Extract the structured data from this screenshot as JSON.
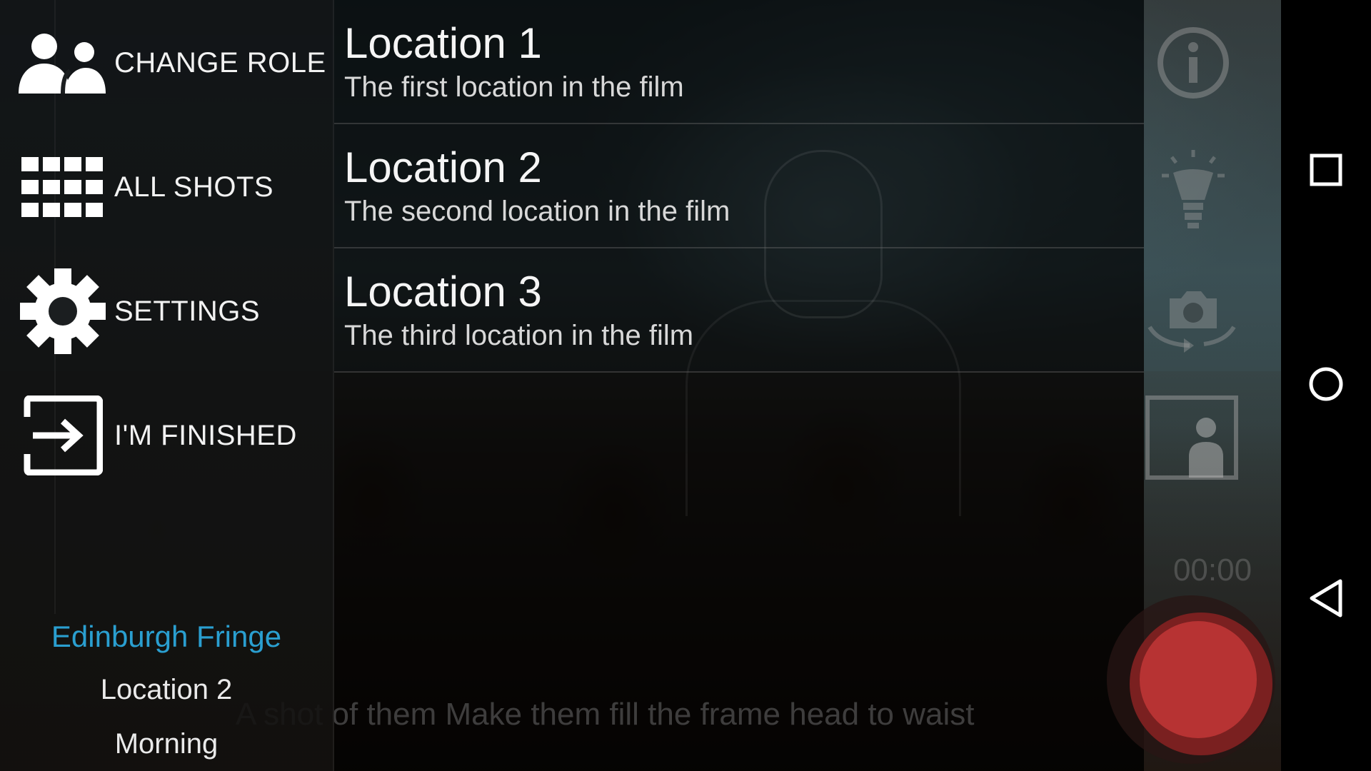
{
  "drawer": {
    "items": [
      {
        "label": "CHANGE ROLE",
        "icon": "people-icon"
      },
      {
        "label": "ALL SHOTS",
        "icon": "grid-icon"
      },
      {
        "label": "SETTINGS",
        "icon": "gear-icon"
      },
      {
        "label": "I'M FINISHED",
        "icon": "exit-icon"
      }
    ],
    "footer": {
      "project": "Edinburgh Fringe",
      "location": "Location 2",
      "time_of_day": "Morning"
    }
  },
  "locations": [
    {
      "title": "Location 1",
      "description": "The first location in the film"
    },
    {
      "title": "Location 2",
      "description": "The second location in the film"
    },
    {
      "title": "Location 3",
      "description": "The third location in the film"
    }
  ],
  "camera": {
    "hint": "A shot of them Make them fill the frame head to waist",
    "timer": "00:00",
    "icons": [
      "info-icon",
      "light-bulb-icon",
      "switch-camera-icon",
      "portrait-frame-icon",
      "record-icon"
    ]
  },
  "navbar": {
    "icons": [
      "recents-icon",
      "home-icon",
      "back-icon"
    ]
  },
  "colors": {
    "accent": "#2a9fd0",
    "record": "#b73333"
  }
}
